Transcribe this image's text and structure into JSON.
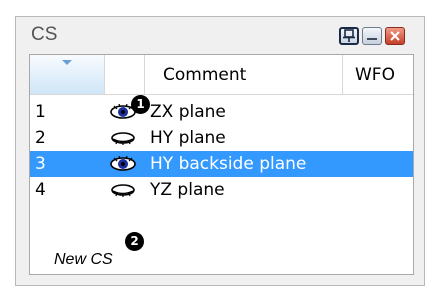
{
  "window": {
    "title": "CS",
    "buttons": {
      "pin": "pin-icon",
      "minimize": "minimize-icon",
      "close": "close-icon"
    }
  },
  "grid": {
    "columns": {
      "comment": "Comment",
      "wfo": "WFO"
    },
    "rows": [
      {
        "num": "1",
        "comment": "ZX plane",
        "visible": true
      },
      {
        "num": "2",
        "comment": "HY plane",
        "visible": false
      },
      {
        "num": "3",
        "comment": "HY backside plane",
        "visible": true,
        "selected": true
      },
      {
        "num": "4",
        "comment": "YZ plane",
        "visible": false
      }
    ],
    "new_row_label": "New CS"
  },
  "callouts": {
    "first": "1",
    "second": "2"
  },
  "colors": {
    "selection": "#3399ff",
    "eye_open": "#1a2e9c"
  }
}
